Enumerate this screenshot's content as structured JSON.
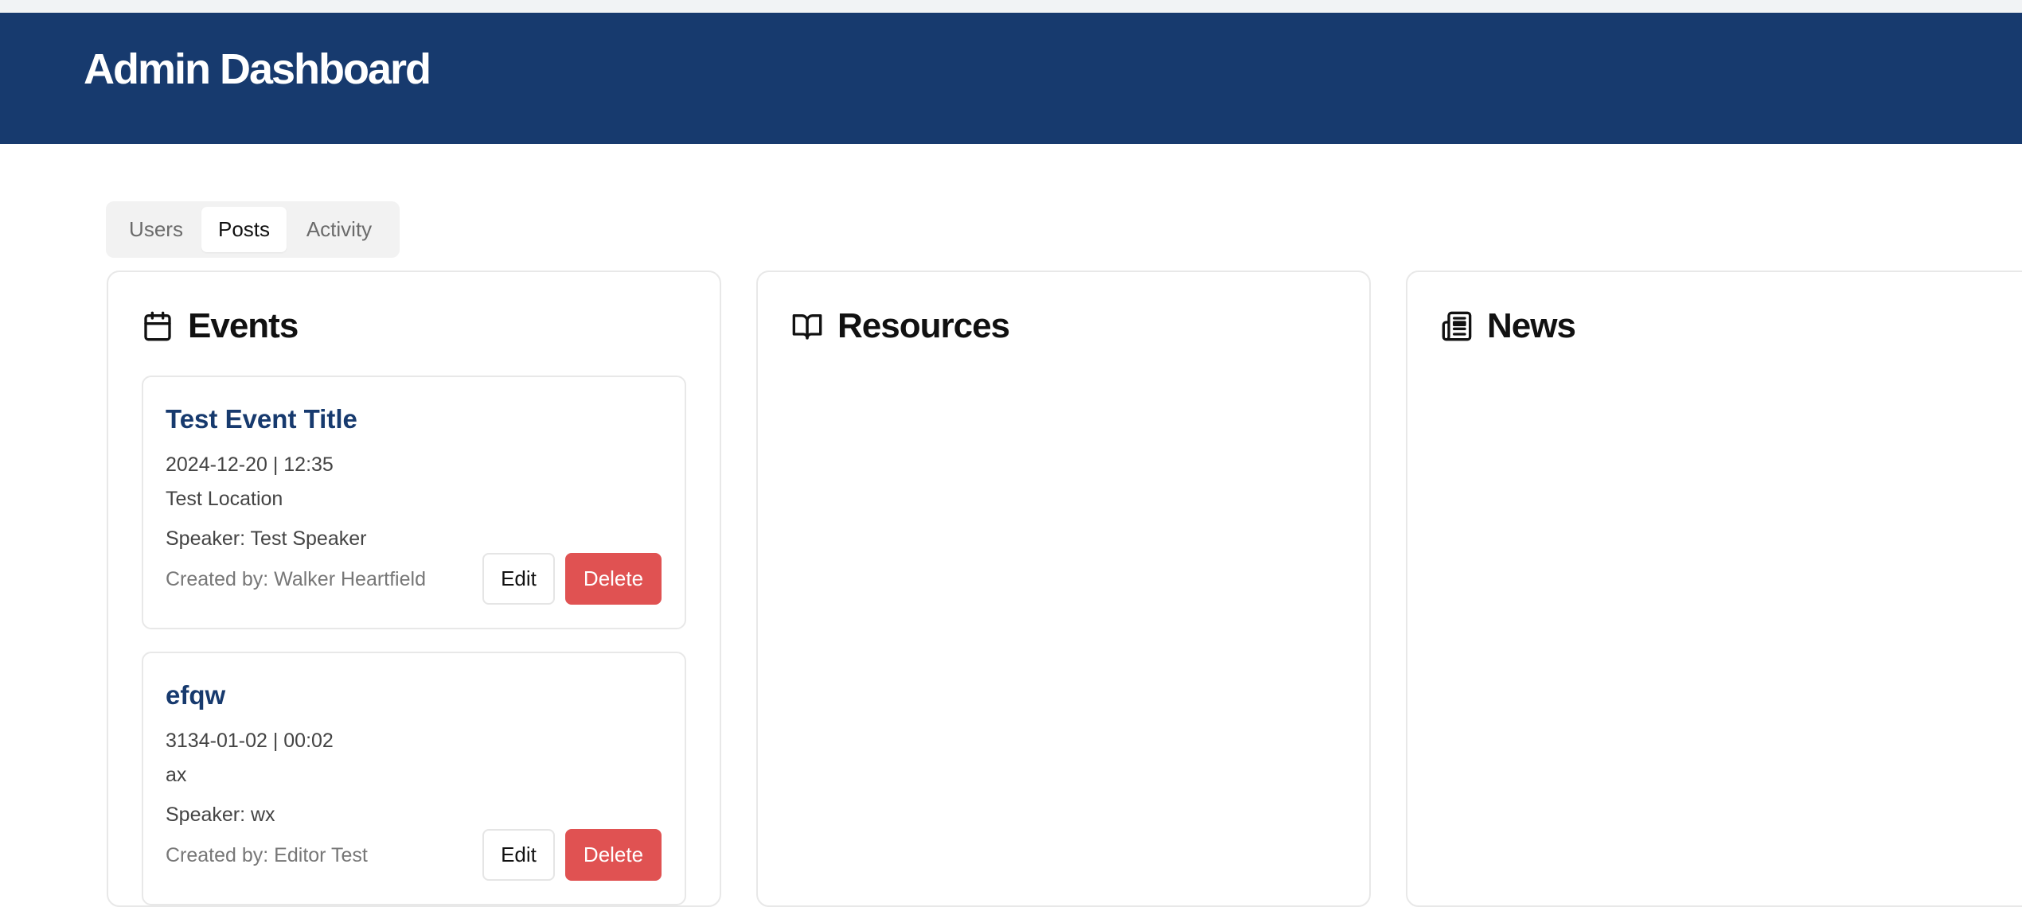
{
  "header": {
    "title": "Admin Dashboard"
  },
  "tabs": [
    {
      "label": "Users",
      "active": false
    },
    {
      "label": "Posts",
      "active": true
    },
    {
      "label": "Activity",
      "active": false
    }
  ],
  "panels": {
    "events": {
      "title": "Events",
      "icon": "calendar-icon"
    },
    "resources": {
      "title": "Resources",
      "icon": "book-open-icon"
    },
    "news": {
      "title": "News",
      "icon": "newspaper-icon"
    }
  },
  "events": [
    {
      "title": "Test Event Title",
      "datetime": "2024-12-20 | 12:35",
      "location": "Test Location",
      "speaker": "Speaker: Test Speaker",
      "created_by": "Created by: Walker Heartfield",
      "edit_label": "Edit",
      "delete_label": "Delete"
    },
    {
      "title": "efqw",
      "datetime": "3134-01-02 | 00:02",
      "location": "ax",
      "speaker": "Speaker: wx",
      "created_by": "Created by: Editor Test",
      "edit_label": "Edit",
      "delete_label": "Delete"
    }
  ],
  "colors": {
    "header_bg": "#173a6e",
    "event_title": "#173a6e",
    "delete_bg": "#e05252"
  }
}
